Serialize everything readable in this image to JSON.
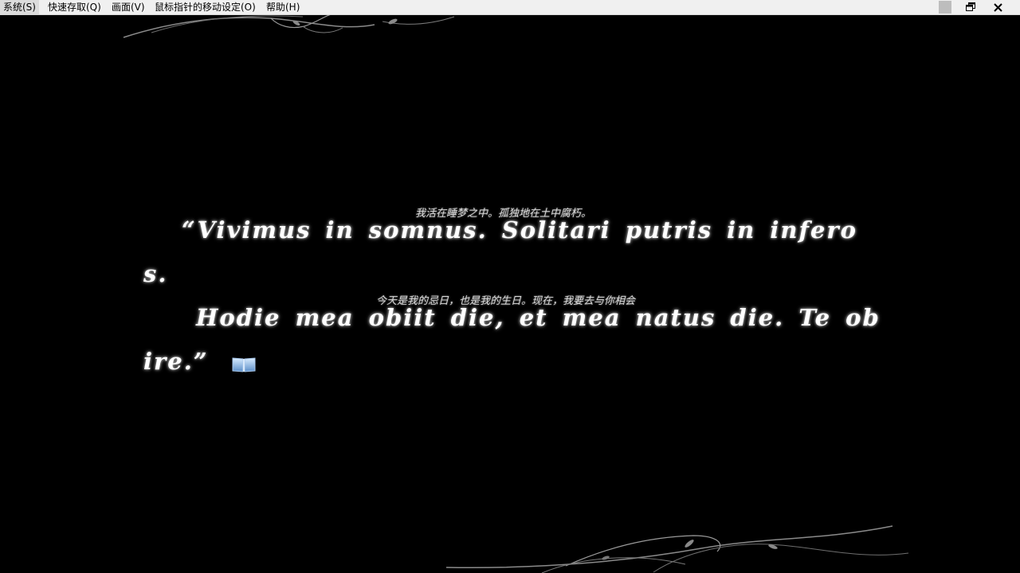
{
  "menubar": {
    "items": [
      {
        "label": "系统(S)"
      },
      {
        "label": "快速存取(Q)"
      },
      {
        "label": "画面(V)"
      },
      {
        "label": "鼠标指针的移动设定(O)"
      },
      {
        "label": "帮助(H)"
      }
    ]
  },
  "window_controls": {
    "minimize_icon": "minimize-icon",
    "restore_icon": "restore-icon",
    "close_icon": "close-icon"
  },
  "dialogue": {
    "ruby_1": "我活在睡梦之中。孤独地在土中腐朽。",
    "line_1": "“Vivimus in somnus. Solitari putris in infero",
    "line_2": "s.",
    "ruby_2": "今天是我的忌日，也是我的生日。现在，我要去与你相会",
    "line_3": "Hodie mea obiit die, et mea natus die. Te ob",
    "line_4": "ire.”",
    "continue_icon": "book-icon"
  },
  "colors": {
    "background": "#000000",
    "text": "#ffffff",
    "menubar": "#f0f0f0",
    "ornament": "#9a9a9a"
  }
}
